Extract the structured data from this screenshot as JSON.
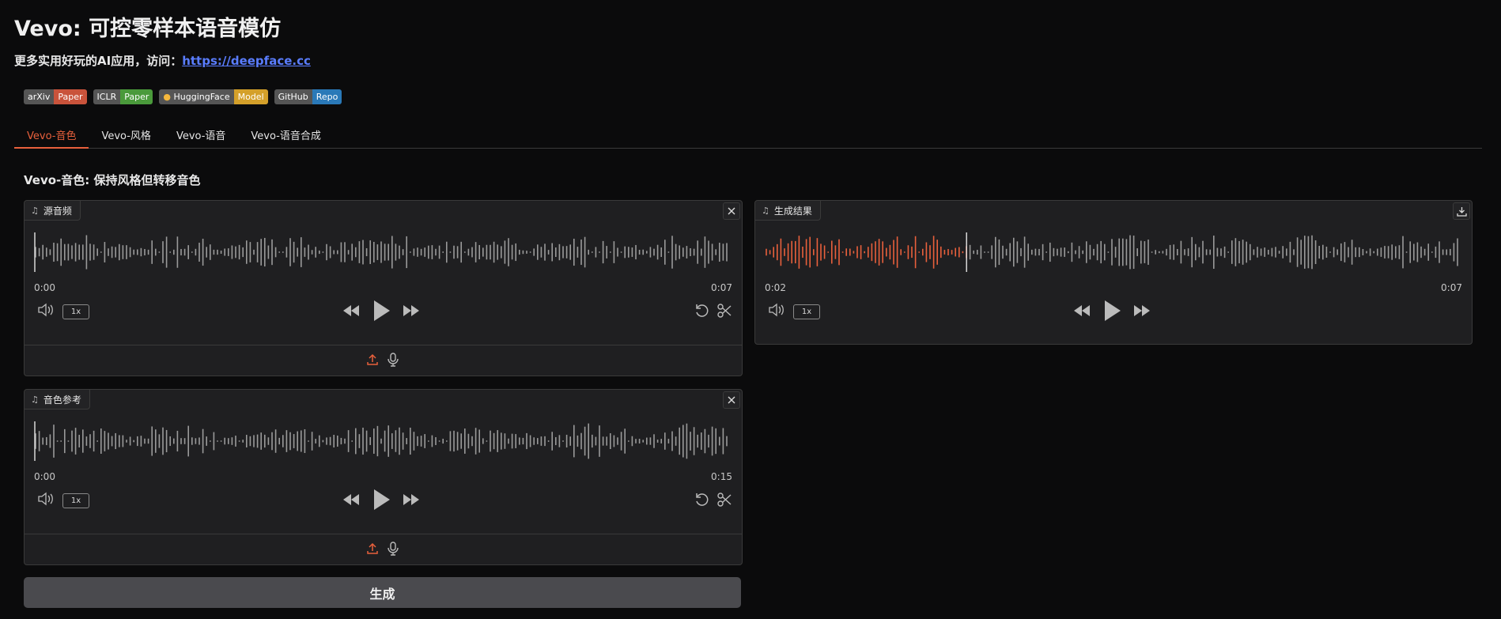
{
  "header": {
    "title": "Vevo: 可控零样本语音模仿",
    "subtitle_prefix": "更多实用好玩的AI应用，访问：",
    "subtitle_link": "https://deepface.cc"
  },
  "badges": [
    {
      "left": "arXiv",
      "right": "Paper",
      "color": "#c9533b"
    },
    {
      "left": "ICLR",
      "right": "Paper",
      "color": "#4a9a3b"
    },
    {
      "left": "HuggingFace",
      "right": "Model",
      "color": "#d4a02a"
    },
    {
      "left": "GitHub",
      "right": "Repo",
      "color": "#2a79b8"
    }
  ],
  "tabs": [
    {
      "label": "Vevo-音色",
      "active": true
    },
    {
      "label": "Vevo-风格",
      "active": false
    },
    {
      "label": "Vevo-语音",
      "active": false
    },
    {
      "label": "Vevo-语音合成",
      "active": false
    }
  ],
  "section_title": "Vevo-音色: 保持风格但转移音色",
  "source_audio": {
    "label": "源音频",
    "time_start": "0:00",
    "time_end": "0:07",
    "rate": "1x"
  },
  "reference_audio": {
    "label": "音色参考",
    "time_start": "0:00",
    "time_end": "0:15",
    "rate": "1x"
  },
  "result_audio": {
    "label": "生成结果",
    "time_start": "0:02",
    "time_end": "0:07",
    "rate": "1x",
    "progress": 0.29
  },
  "generate_button": "生成",
  "colors": {
    "accent": "#e8603c",
    "link": "#5a7dff",
    "wave": "#9a9a9a"
  }
}
